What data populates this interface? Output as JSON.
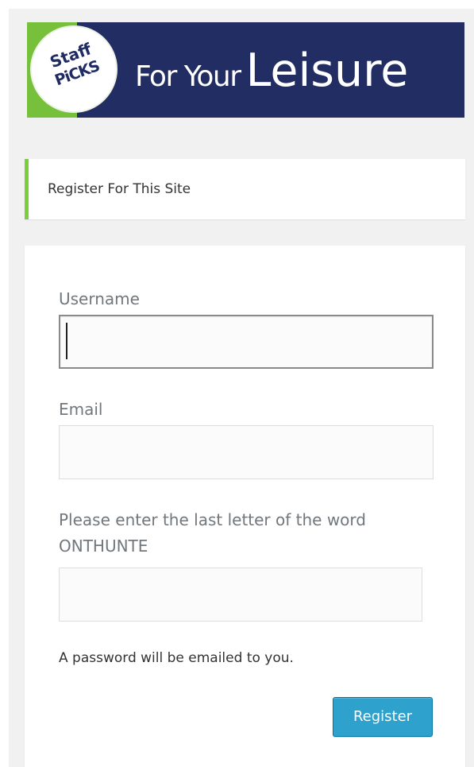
{
  "banner": {
    "badge_line1": "Staff",
    "badge_line2": "PiCKS",
    "title_small": "For Your",
    "title_big": "Leisure",
    "colors": {
      "navy": "#222d63",
      "green": "#76c03b"
    }
  },
  "notice": {
    "text": "Register For This Site",
    "accent_color": "#7ad03a"
  },
  "form": {
    "username_label": "Username",
    "username_value": "",
    "email_label": "Email",
    "email_value": "",
    "captcha_label_line1": "Please enter the last letter of the word",
    "captcha_label_line2": "ONTHUNTE",
    "captcha_value": "",
    "password_hint": "A password will be emailed to you.",
    "register_label": "Register",
    "register_color": "#2ea2cc"
  }
}
